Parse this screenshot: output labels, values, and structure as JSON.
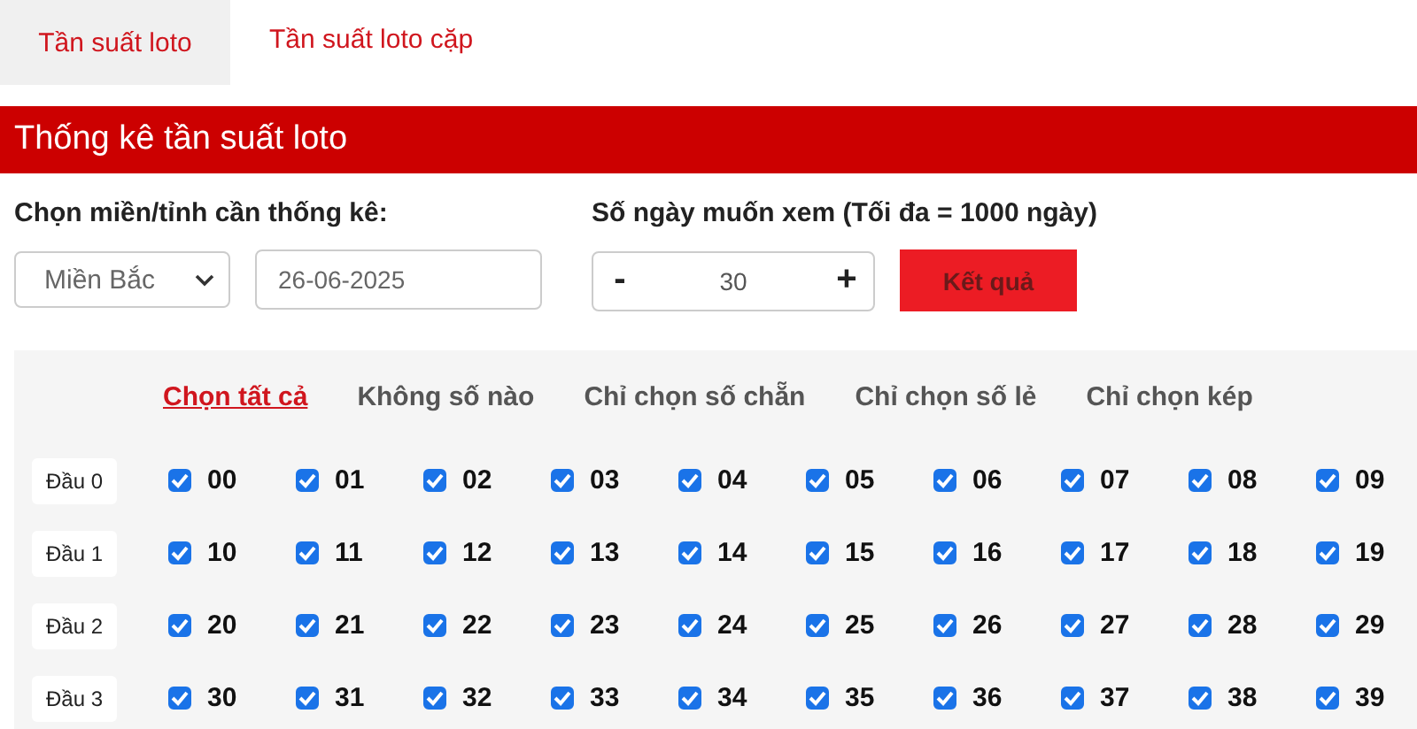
{
  "tabs": [
    {
      "label": "Tần suất loto",
      "selected": true
    },
    {
      "label": "Tần suất loto cặp",
      "selected": false
    }
  ],
  "header": {
    "title": "Thống kê tần suất loto"
  },
  "form": {
    "region_label": "Chọn miền/tỉnh cần thống kê:",
    "region_value": "Miền Bắc",
    "date_value": "26-06-2025",
    "days_label": "Số ngày muốn xem (Tối đa = 1000 ngày)",
    "minus": "-",
    "days_value": "30",
    "plus": "+",
    "submit": "Kết quả"
  },
  "filters": [
    {
      "label": "Chọn tất cả",
      "selected": true
    },
    {
      "label": "Không số nào",
      "selected": false
    },
    {
      "label": "Chỉ chọn số chẵn",
      "selected": false
    },
    {
      "label": "Chỉ chọn số lẻ",
      "selected": false
    },
    {
      "label": "Chỉ chọn kép",
      "selected": false
    }
  ],
  "rows": [
    {
      "label": "Đầu 0",
      "numbers": [
        {
          "number": "00",
          "checked": true
        },
        {
          "number": "01",
          "checked": true
        },
        {
          "number": "02",
          "checked": true
        },
        {
          "number": "03",
          "checked": true
        },
        {
          "number": "04",
          "checked": true
        },
        {
          "number": "05",
          "checked": true
        },
        {
          "number": "06",
          "checked": true
        },
        {
          "number": "07",
          "checked": true
        },
        {
          "number": "08",
          "checked": true
        },
        {
          "number": "09",
          "checked": true
        }
      ]
    },
    {
      "label": "Đầu 1",
      "numbers": [
        {
          "number": "10",
          "checked": true
        },
        {
          "number": "11",
          "checked": true
        },
        {
          "number": "12",
          "checked": true
        },
        {
          "number": "13",
          "checked": true
        },
        {
          "number": "14",
          "checked": true
        },
        {
          "number": "15",
          "checked": true
        },
        {
          "number": "16",
          "checked": true
        },
        {
          "number": "17",
          "checked": true
        },
        {
          "number": "18",
          "checked": true
        },
        {
          "number": "19",
          "checked": true
        }
      ]
    },
    {
      "label": "Đầu 2",
      "numbers": [
        {
          "number": "20",
          "checked": true
        },
        {
          "number": "21",
          "checked": true
        },
        {
          "number": "22",
          "checked": true
        },
        {
          "number": "23",
          "checked": true
        },
        {
          "number": "24",
          "checked": true
        },
        {
          "number": "25",
          "checked": true
        },
        {
          "number": "26",
          "checked": true
        },
        {
          "number": "27",
          "checked": true
        },
        {
          "number": "28",
          "checked": true
        },
        {
          "number": "29",
          "checked": true
        }
      ]
    },
    {
      "label": "Đầu 3",
      "numbers": [
        {
          "number": "30",
          "checked": true
        },
        {
          "number": "31",
          "checked": true
        },
        {
          "number": "32",
          "checked": true
        },
        {
          "number": "33",
          "checked": true
        },
        {
          "number": "34",
          "checked": true
        },
        {
          "number": "35",
          "checked": true
        },
        {
          "number": "36",
          "checked": true
        },
        {
          "number": "37",
          "checked": true
        },
        {
          "number": "38",
          "checked": true
        },
        {
          "number": "39",
          "checked": true
        }
      ]
    }
  ]
}
